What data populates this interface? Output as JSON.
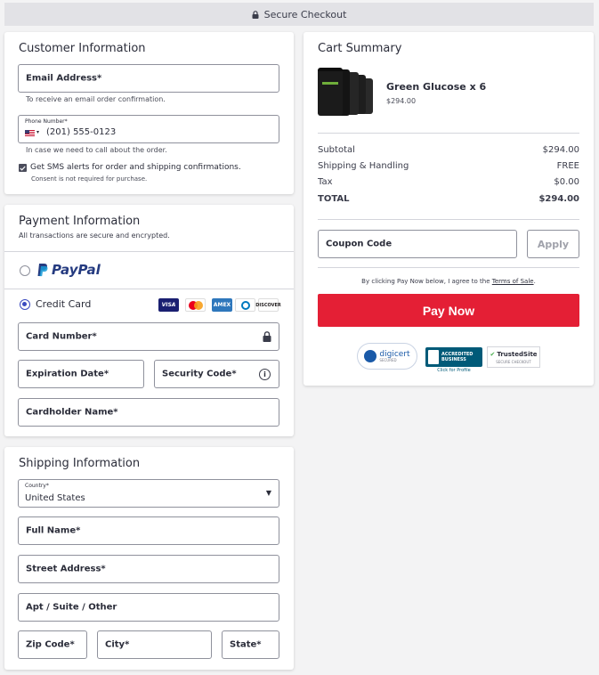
{
  "header": {
    "title": "Secure Checkout"
  },
  "customer": {
    "title": "Customer Information",
    "email_label": "Email Address*",
    "email_hint": "To receive an email order confirmation.",
    "phone_label": "Phone Number*",
    "phone_value": "(201) 555-0123",
    "phone_hint": "In case we need to call about the order.",
    "sms_label": "Get SMS alerts for order and shipping confirmations.",
    "sms_hint": "Consent is not required for purchase.",
    "sms_checked": true
  },
  "payment": {
    "title": "Payment Information",
    "subtitle": "All transactions are secure and encrypted.",
    "paypal_label": "PayPal",
    "credit_card_label": "Credit Card",
    "card_brands": [
      "VISA",
      "Mastercard",
      "AMEX",
      "Diners",
      "DISCOVER"
    ],
    "card_number_label": "Card Number*",
    "expiration_label": "Expiration Date*",
    "security_label": "Security Code*",
    "cardholder_label": "Cardholder Name*"
  },
  "shipping": {
    "title": "Shipping Information",
    "country_label": "Country*",
    "country_value": "United States",
    "full_name_label": "Full Name*",
    "street_label": "Street Address*",
    "apt_label": "Apt / Suite / Other",
    "zip_label": "Zip Code*",
    "city_label": "City*",
    "state_label": "State*"
  },
  "cart": {
    "title": "Cart Summary",
    "product_name": "Green Glucose x 6",
    "product_price": "$294.00",
    "subtotal_label": "Subtotal",
    "subtotal_value": "$294.00",
    "shipping_label": "Shipping & Handling",
    "shipping_value": "FREE",
    "tax_label": "Tax",
    "tax_value": "$0.00",
    "total_label": "TOTAL",
    "total_value": "$294.00",
    "coupon_label": "Coupon Code",
    "apply_label": "Apply",
    "terms_prefix": "By clicking Pay Now below, I agree to the ",
    "terms_link": "Terms of Sale",
    "terms_suffix": ".",
    "pay_label": "Pay Now"
  },
  "badges": {
    "digicert": "digicert",
    "digicert_sub": "SECURED",
    "bbb_line1": "ACCREDITED",
    "bbb_line2": "BUSINESS",
    "bbb_sub": "Click for Profile",
    "trusted": "TrustedSite",
    "trusted_sub": "SECURE CHECKOUT"
  },
  "colors": {
    "accent": "#3a4abf",
    "pay_button": "#e41f35",
    "paypal_dark": "#253b80",
    "paypal_light": "#179bd7"
  }
}
